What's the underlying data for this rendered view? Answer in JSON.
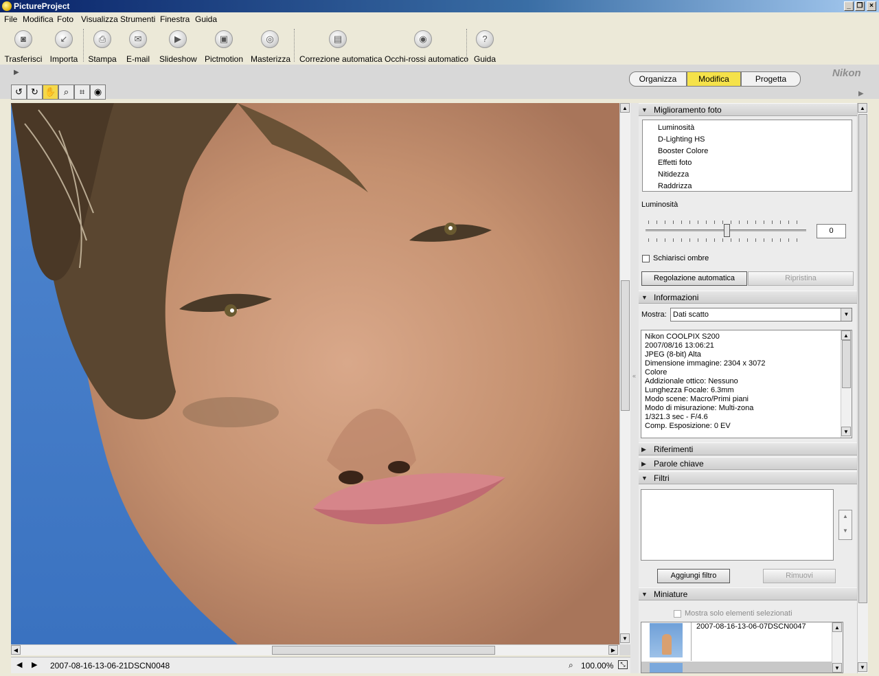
{
  "window": {
    "title": "PictureProject"
  },
  "menu": [
    "File",
    "Modifica",
    "Foto",
    "Visualizza",
    "Strumenti",
    "Finestra",
    "Guida"
  ],
  "toolbar": [
    {
      "label": "Trasferisci",
      "icon": "camera-icon"
    },
    {
      "label": "Importa",
      "icon": "import-icon"
    },
    {
      "label": "Stampa",
      "icon": "printer-icon"
    },
    {
      "label": "E-mail",
      "icon": "envelope-icon"
    },
    {
      "label": "Slideshow",
      "icon": "slideshow-icon"
    },
    {
      "label": "Pictmotion",
      "icon": "pictmotion-icon"
    },
    {
      "label": "Masterizza",
      "icon": "disc-icon"
    },
    {
      "label": "Correzione automatica",
      "icon": "auto-correct-icon"
    },
    {
      "label": "Occhi-rossi automatico",
      "icon": "eye-icon"
    },
    {
      "label": "Guida",
      "icon": "help-icon"
    }
  ],
  "modes": [
    {
      "label": "Organizza",
      "active": false
    },
    {
      "label": "Modifica",
      "active": true
    },
    {
      "label": "Progetta",
      "active": false
    }
  ],
  "brand": "Nikon",
  "view_tools": [
    "rotate-left-icon",
    "rotate-right-icon",
    "hand-icon",
    "magnifier-icon",
    "crop-icon",
    "eye-icon"
  ],
  "status": {
    "filename": "2007-08-16-13-06-21DSCN0048",
    "zoom": "100.00%"
  },
  "panel": {
    "enhance": {
      "title": "Miglioramento foto",
      "items": [
        "Luminosità",
        "D-Lighting HS",
        "Booster Colore",
        "Effetti foto",
        "Nitidezza",
        "Raddrizza"
      ],
      "control_label": "Luminosità",
      "slider_value": "0",
      "shadows_label": "Schiarisci ombre",
      "auto_button": "Regolazione automatica",
      "reset_button": "Ripristina"
    },
    "info": {
      "title": "Informazioni",
      "show_label": "Mostra:",
      "show_value": "Dati scatto",
      "lines": [
        "Nikon COOLPIX S200",
        "2007/08/16 13:06:21",
        "JPEG (8-bit) Alta",
        "Dimensione immagine: 2304 x 3072",
        "Colore",
        "Addizionale ottico: Nessuno",
        "Lunghezza Focale: 6.3mm",
        "Modo scene: Macro/Primi piani",
        "Modo di misurazione: Multi-zona",
        "1/321.3 sec - F/4.6",
        "Comp. Esposizione: 0 EV"
      ]
    },
    "refs": {
      "title": "Riferimenti"
    },
    "keywords": {
      "title": "Parole chiave"
    },
    "filters": {
      "title": "Filtri",
      "add_button": "Aggiungi filtro",
      "remove_button": "Rimuovi"
    },
    "thumbs": {
      "title": "Miniature",
      "only_selected_label": "Mostra solo elementi selezionati",
      "caption": "2007-08-16-13-06-07DSCN0047"
    }
  }
}
